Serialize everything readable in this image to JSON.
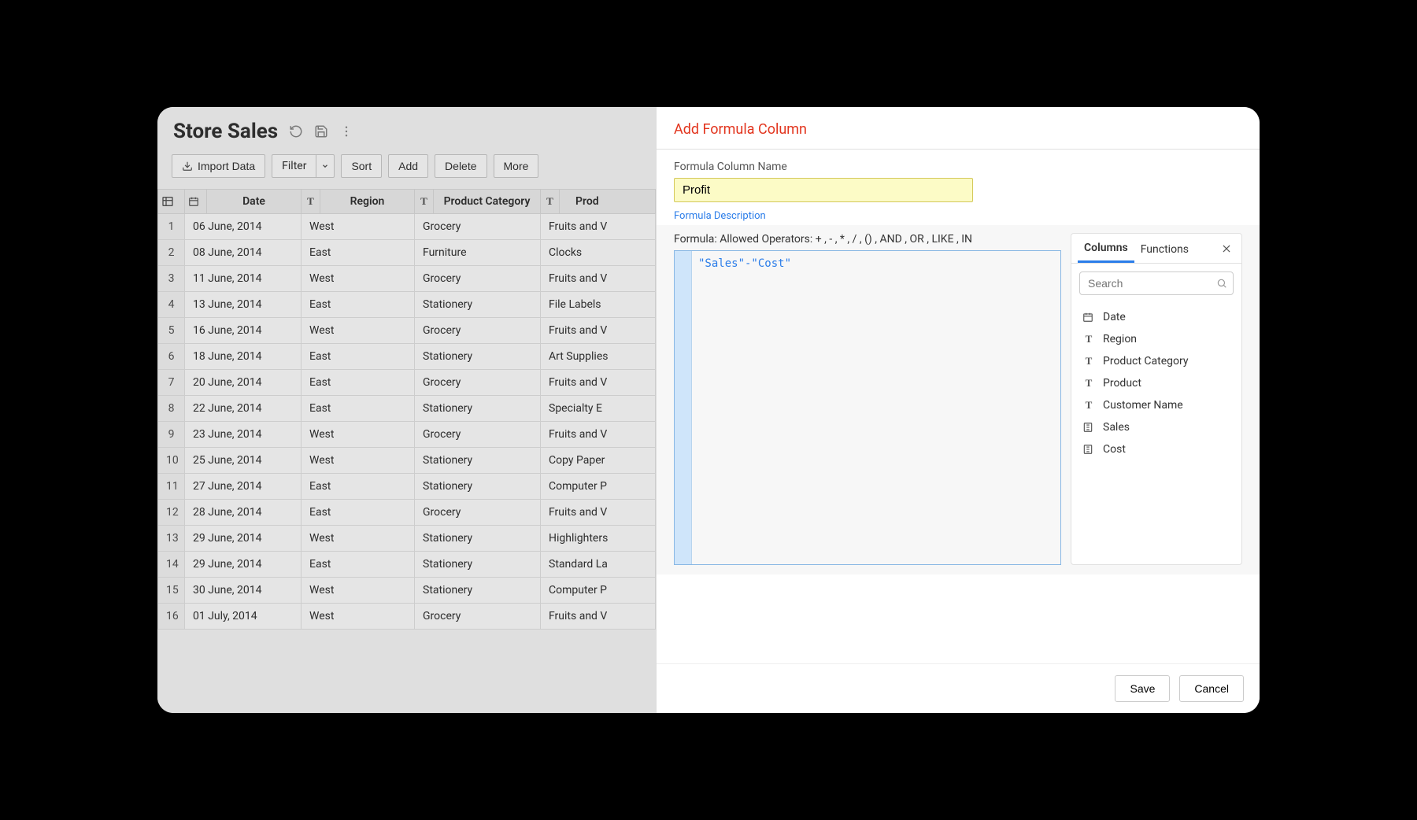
{
  "title": "Store Sales",
  "toolbar": {
    "import": "Import Data",
    "filter": "Filter",
    "sort": "Sort",
    "add": "Add",
    "delete": "Delete",
    "more": "More"
  },
  "columns": [
    {
      "label": "Date",
      "type": "date"
    },
    {
      "label": "Region",
      "type": "text"
    },
    {
      "label": "Product Category",
      "type": "text"
    },
    {
      "label": "Product",
      "type": "text"
    }
  ],
  "product_header_truncated": "Prod",
  "rows": [
    {
      "n": 1,
      "date": "06 June, 2014",
      "region": "West",
      "category": "Grocery",
      "product": "Fruits and V"
    },
    {
      "n": 2,
      "date": "08 June, 2014",
      "region": "East",
      "category": "Furniture",
      "product": "Clocks"
    },
    {
      "n": 3,
      "date": "11 June, 2014",
      "region": "West",
      "category": "Grocery",
      "product": "Fruits and V"
    },
    {
      "n": 4,
      "date": "13 June, 2014",
      "region": "East",
      "category": "Stationery",
      "product": "File Labels"
    },
    {
      "n": 5,
      "date": "16 June, 2014",
      "region": "West",
      "category": "Grocery",
      "product": "Fruits and V"
    },
    {
      "n": 6,
      "date": "18 June, 2014",
      "region": "East",
      "category": "Stationery",
      "product": "Art Supplies"
    },
    {
      "n": 7,
      "date": "20 June, 2014",
      "region": "East",
      "category": "Grocery",
      "product": "Fruits and V"
    },
    {
      "n": 8,
      "date": "22 June, 2014",
      "region": "East",
      "category": "Stationery",
      "product": "Specialty E"
    },
    {
      "n": 9,
      "date": "23 June, 2014",
      "region": "West",
      "category": "Grocery",
      "product": "Fruits and V"
    },
    {
      "n": 10,
      "date": "25 June, 2014",
      "region": "West",
      "category": "Stationery",
      "product": "Copy Paper"
    },
    {
      "n": 11,
      "date": "27 June, 2014",
      "region": "East",
      "category": "Stationery",
      "product": "Computer P"
    },
    {
      "n": 12,
      "date": "28 June, 2014",
      "region": "East",
      "category": "Grocery",
      "product": "Fruits and V"
    },
    {
      "n": 13,
      "date": "29 June, 2014",
      "region": "West",
      "category": "Stationery",
      "product": "Highlighters"
    },
    {
      "n": 14,
      "date": "29 June, 2014",
      "region": "East",
      "category": "Stationery",
      "product": "Standard La"
    },
    {
      "n": 15,
      "date": "30 June, 2014",
      "region": "West",
      "category": "Stationery",
      "product": "Computer P"
    },
    {
      "n": 16,
      "date": "01 July, 2014",
      "region": "West",
      "category": "Grocery",
      "product": "Fruits and V"
    }
  ],
  "panel": {
    "title": "Add Formula Column",
    "name_label": "Formula Column Name",
    "name_value": "Profit",
    "desc_link": "Formula Description",
    "formula_hint": "Formula: Allowed Operators: + , - , * , / , () , AND , OR , LIKE , IN",
    "formula_text": "\"Sales\"-\"Cost\"",
    "tabs": {
      "columns": "Columns",
      "functions": "Functions"
    },
    "search_placeholder": "Search",
    "column_list": [
      {
        "name": "Date",
        "type": "date"
      },
      {
        "name": "Region",
        "type": "text"
      },
      {
        "name": "Product Category",
        "type": "text"
      },
      {
        "name": "Product",
        "type": "text"
      },
      {
        "name": "Customer Name",
        "type": "text"
      },
      {
        "name": "Sales",
        "type": "number"
      },
      {
        "name": "Cost",
        "type": "number"
      }
    ],
    "save": "Save",
    "cancel": "Cancel"
  }
}
